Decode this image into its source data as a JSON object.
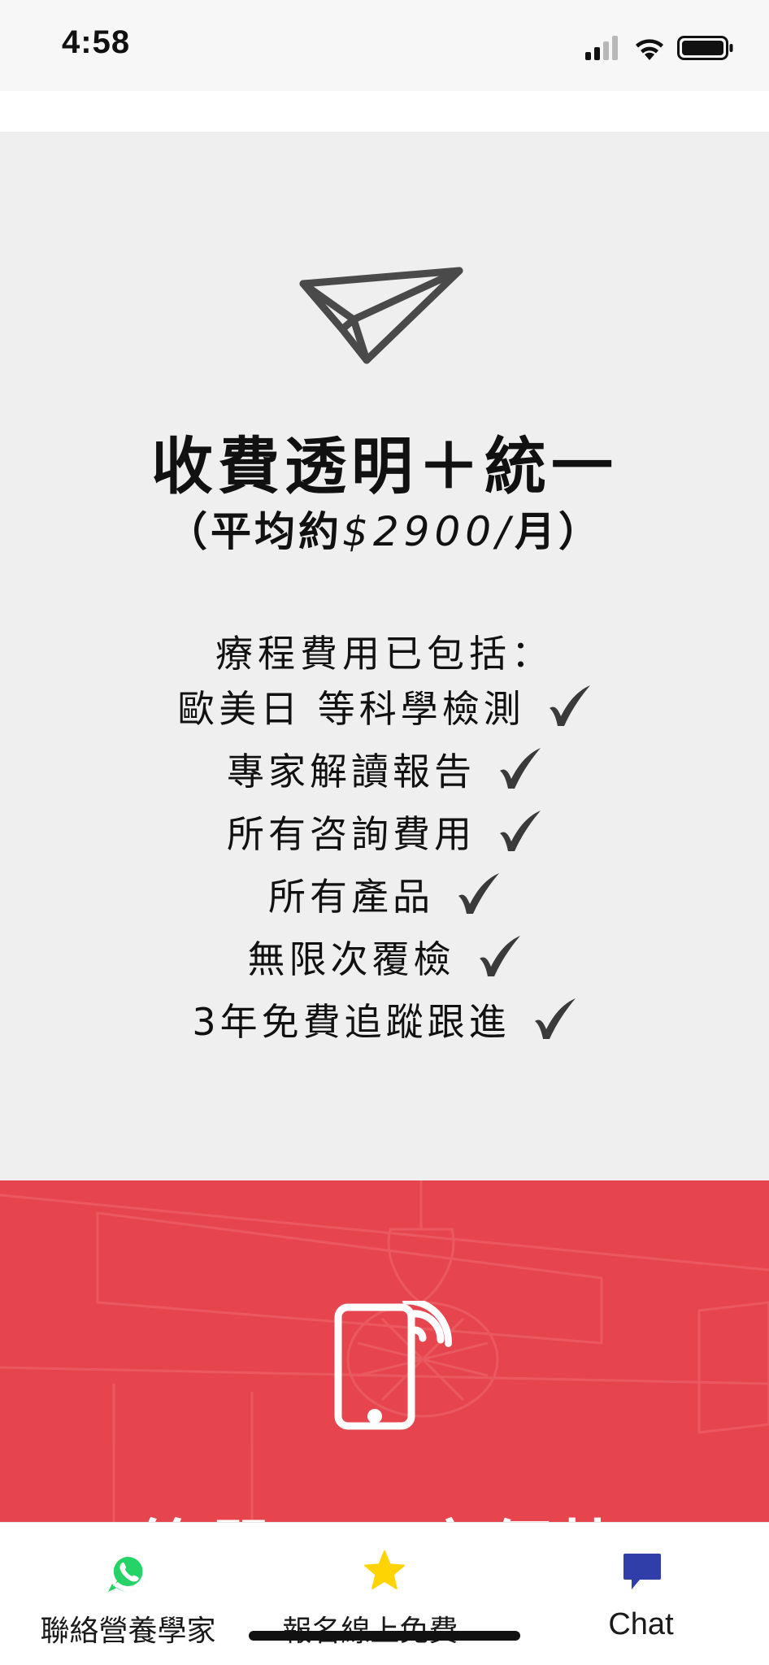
{
  "status_bar": {
    "time": "4:58",
    "icons": [
      "cellular-signal-icon",
      "wifi-icon",
      "battery-icon"
    ]
  },
  "pricing": {
    "icon": "paper-plane-icon",
    "headline": "收費透明＋統一",
    "subline_prefix": "（平均約",
    "subline_price": "$2900/",
    "subline_suffix": "月）",
    "includes_title": "療程費用已包括：",
    "features": [
      "歐美日 等科學檢測",
      "專家解讀報告",
      "所有咨詢費用",
      "所有產品",
      "無限次覆檢",
      "3年免費追蹤跟進"
    ],
    "check_icon": "checkmark-icon"
  },
  "contact_section": {
    "icon": "mobile-phone-signal-icon",
    "heading_partial": "簡單　　方便快"
  },
  "bottom_nav": {
    "items": [
      {
        "label": "聯絡營養學家",
        "icon": "whatsapp-icon",
        "color": "#25d366"
      },
      {
        "label": "報名線上免費...",
        "icon": "star-icon",
        "color": "#ffd400"
      },
      {
        "label": "Chat",
        "icon": "chat-bubble-icon",
        "color": "#2f3ea8"
      }
    ]
  },
  "colors": {
    "gray_bg": "#efefef",
    "red_bg": "#e6454d",
    "text": "#111111"
  }
}
